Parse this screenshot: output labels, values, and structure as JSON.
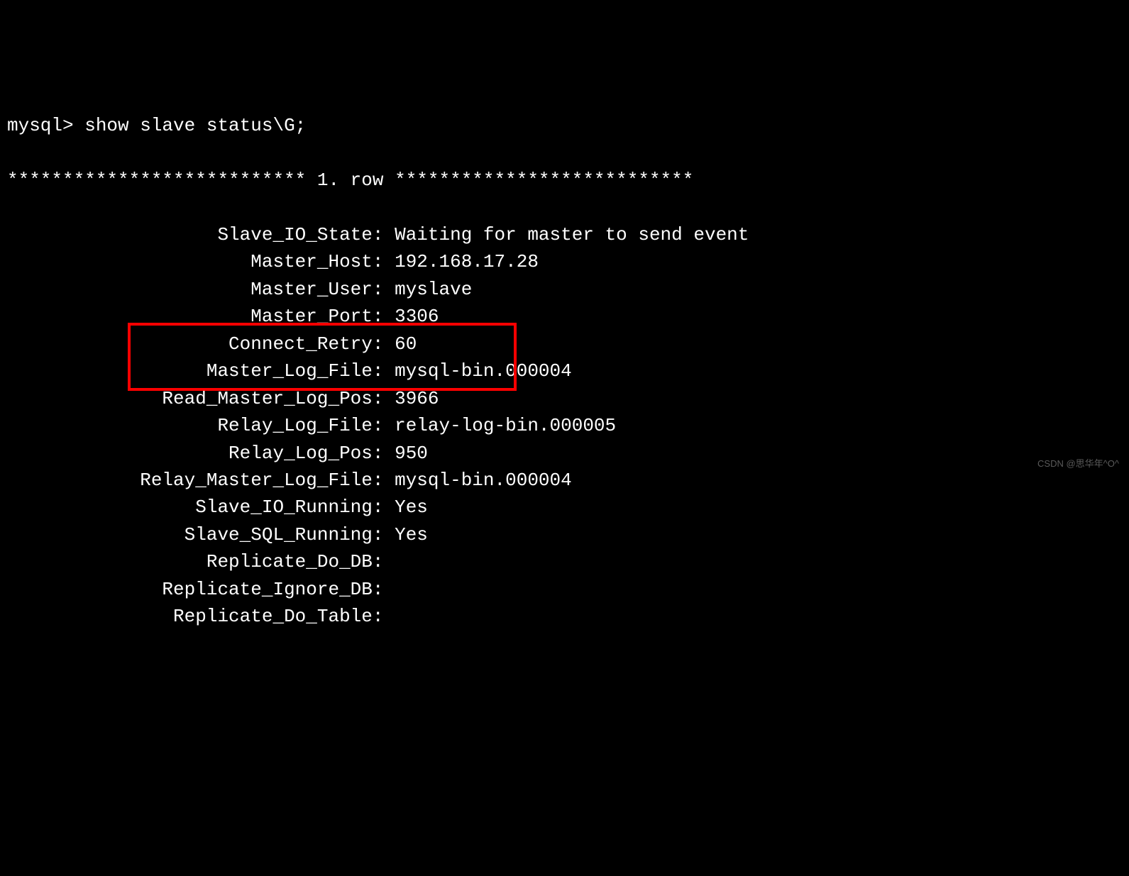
{
  "prompt": "mysql> show slave status\\G;",
  "row_header": "*************************** 1. row ***************************",
  "fields": [
    {
      "label": "Slave_IO_State",
      "value": "Waiting for master to send event"
    },
    {
      "label": "Master_Host",
      "value": "192.168.17.28"
    },
    {
      "label": "Master_User",
      "value": "myslave"
    },
    {
      "label": "Master_Port",
      "value": "3306"
    },
    {
      "label": "Connect_Retry",
      "value": "60"
    },
    {
      "label": "Master_Log_File",
      "value": "mysql-bin.000004"
    },
    {
      "label": "Read_Master_Log_Pos",
      "value": "3966"
    },
    {
      "label": "Relay_Log_File",
      "value": "relay-log-bin.000005"
    },
    {
      "label": "Relay_Log_Pos",
      "value": "950"
    },
    {
      "label": "Relay_Master_Log_File",
      "value": "mysql-bin.000004"
    },
    {
      "label": "Slave_IO_Running",
      "value": "Yes"
    },
    {
      "label": "Slave_SQL_Running",
      "value": "Yes"
    },
    {
      "label": "Replicate_Do_DB",
      "value": ""
    },
    {
      "label": "Replicate_Ignore_DB",
      "value": ""
    },
    {
      "label": "Replicate_Do_Table",
      "value": ""
    }
  ],
  "label_width": 33,
  "watermark": "CSDN @思华年^O^"
}
